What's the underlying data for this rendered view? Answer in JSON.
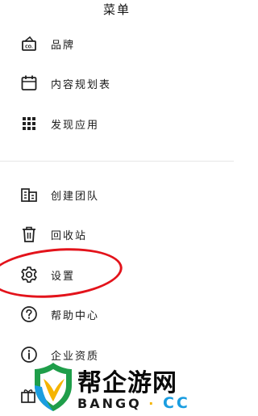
{
  "header": {
    "title": "菜单"
  },
  "menu": {
    "items": [
      {
        "label": "品牌",
        "icon": "brand-card-icon"
      },
      {
        "label": "内容规划表",
        "icon": "calendar-icon"
      },
      {
        "label": "发现应用",
        "icon": "apps-grid-icon"
      },
      {
        "label": "创建团队",
        "icon": "team-building-icon"
      },
      {
        "label": "回收站",
        "icon": "trash-icon"
      },
      {
        "label": "设置",
        "icon": "gear-icon"
      },
      {
        "label": "帮助中心",
        "icon": "help-icon"
      },
      {
        "label": "企业资质",
        "icon": "info-icon"
      }
    ]
  },
  "brand_icon_text": "CO.",
  "highlight_color": "#e3131b",
  "watermark": {
    "name": "帮企游网",
    "domain_left": "BANGQ",
    "domain_dot": "·",
    "domain_right": "CC"
  }
}
